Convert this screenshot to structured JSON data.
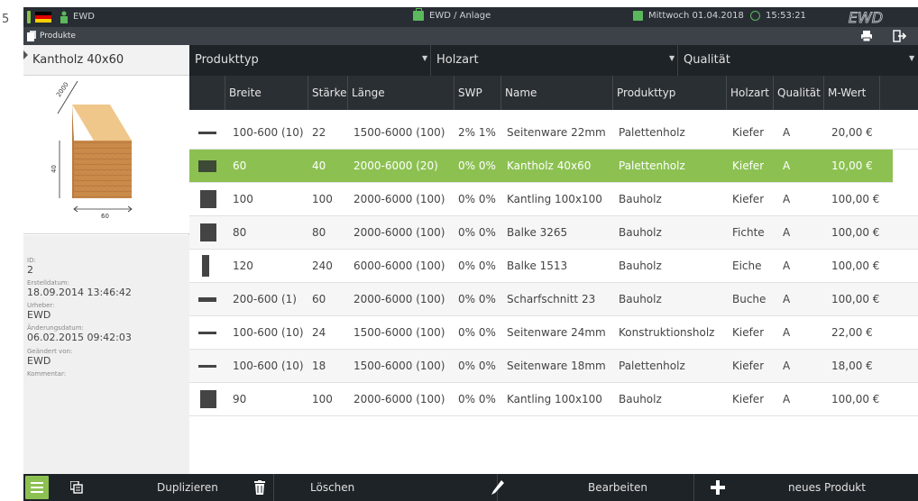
{
  "page_number": "5",
  "topbar": {
    "user": "EWD",
    "breadcrumb": "EWD / Anlage",
    "date": "Mittwoch  01.04.2018",
    "time": "15:53:21",
    "logo_text": "EWD",
    "accent_color": "#5cb85c"
  },
  "subbar": {
    "section": "Produkte",
    "icons": [
      "printer-icon",
      "logout-icon"
    ]
  },
  "left_panel": {
    "title": "Kantholz 40x60",
    "drawing": {
      "length_label": "2000",
      "height_label": "40",
      "width_label": "60"
    },
    "fields": [
      {
        "label": "ID:",
        "value": "2"
      },
      {
        "label": "Erstelldatum:",
        "value": "18.09.2014 13:46:42"
      },
      {
        "label": "Urheber:",
        "value": "EWD"
      },
      {
        "label": "Änderungsdatum:",
        "value": "06.02.2015 09:42:03"
      },
      {
        "label": "Geändert von:",
        "value": "EWD"
      },
      {
        "label": "Kommentar:",
        "value": ""
      }
    ]
  },
  "filters": [
    {
      "label": "Produkttyp"
    },
    {
      "label": "Holzart"
    },
    {
      "label": "Qualität"
    }
  ],
  "table": {
    "columns": [
      "Breite",
      "Stärke",
      "Länge",
      "SWP",
      "Name",
      "Produkttyp",
      "Holzart",
      "Qualität",
      "M-Wert"
    ],
    "rows": [
      {
        "shape": "flat",
        "breite": "100-600 (10)",
        "staerke": "22",
        "laenge": "1500-6000 (100)",
        "swp": "2% 1%",
        "name": "Seitenware 22mm",
        "produkttyp": "Palettenholz",
        "holzart": "Kiefer",
        "qualitaet": "A",
        "mwert": "20,00 €"
      },
      {
        "shape": "rect",
        "breite": "60",
        "staerke": "40",
        "laenge": "2000-6000 (20)",
        "swp": "0% 0%",
        "name": "Kantholz 40x60",
        "produkttyp": "Palettenholz",
        "holzart": "Kiefer",
        "qualitaet": "A",
        "mwert": "10,00 €"
      },
      {
        "shape": "square",
        "breite": "100",
        "staerke": "100",
        "laenge": "2000-6000 (100)",
        "swp": "0% 0%",
        "name": "Kantling 100x100",
        "produkttyp": "Bauholz",
        "holzart": "Kiefer",
        "qualitaet": "A",
        "mwert": "100,00 €"
      },
      {
        "shape": "square",
        "breite": "80",
        "staerke": "80",
        "laenge": "2000-6000 (100)",
        "swp": "0% 0%",
        "name": "Balke 3265",
        "produkttyp": "Bauholz",
        "holzart": "Fichte",
        "qualitaet": "A",
        "mwert": "100,00 €"
      },
      {
        "shape": "tall",
        "breite": "120",
        "staerke": "240",
        "laenge": "6000-6000 (100)",
        "swp": "0% 0%",
        "name": "Balke 1513",
        "produkttyp": "Bauholz",
        "holzart": "Eiche",
        "qualitaet": "A",
        "mwert": "100,00 €"
      },
      {
        "shape": "flat2",
        "breite": "200-600 (1)",
        "staerke": "60",
        "laenge": "2000-6000 (100)",
        "swp": "0% 0%",
        "name": "Scharfschnitt 23",
        "produkttyp": "Bauholz",
        "holzart": "Buche",
        "qualitaet": "A",
        "mwert": "100,00 €"
      },
      {
        "shape": "flat",
        "breite": "100-600 (10)",
        "staerke": "24",
        "laenge": "1500-6000 (100)",
        "swp": "0% 0%",
        "name": "Seitenware 24mm",
        "produkttyp": "Konstruktionsholz",
        "holzart": "Kiefer",
        "qualitaet": "A",
        "mwert": "22,00 €"
      },
      {
        "shape": "flat",
        "breite": "100-600 (10)",
        "staerke": "18",
        "laenge": "1500-6000 (100)",
        "swp": "0% 0%",
        "name": "Seitenware 18mm",
        "produkttyp": "Palettenholz",
        "holzart": "Kiefer",
        "qualitaet": "A",
        "mwert": "18,00 €"
      },
      {
        "shape": "square",
        "breite": "90",
        "staerke": "100",
        "laenge": "2000-6000 (100)",
        "swp": "0% 0%",
        "name": "Kantling 100x100",
        "produkttyp": "Bauholz",
        "holzart": "Kiefer",
        "qualitaet": "A",
        "mwert": "100,00 €"
      }
    ]
  },
  "bottombar": {
    "duplicate": "Duplizieren",
    "delete": "Löschen",
    "edit": "Bearbeiten",
    "new": "neues Produkt"
  },
  "colors": {
    "selected_row": "#8cc152",
    "header_bg": "#2a2f34",
    "bar_bg": "#1e2327"
  }
}
